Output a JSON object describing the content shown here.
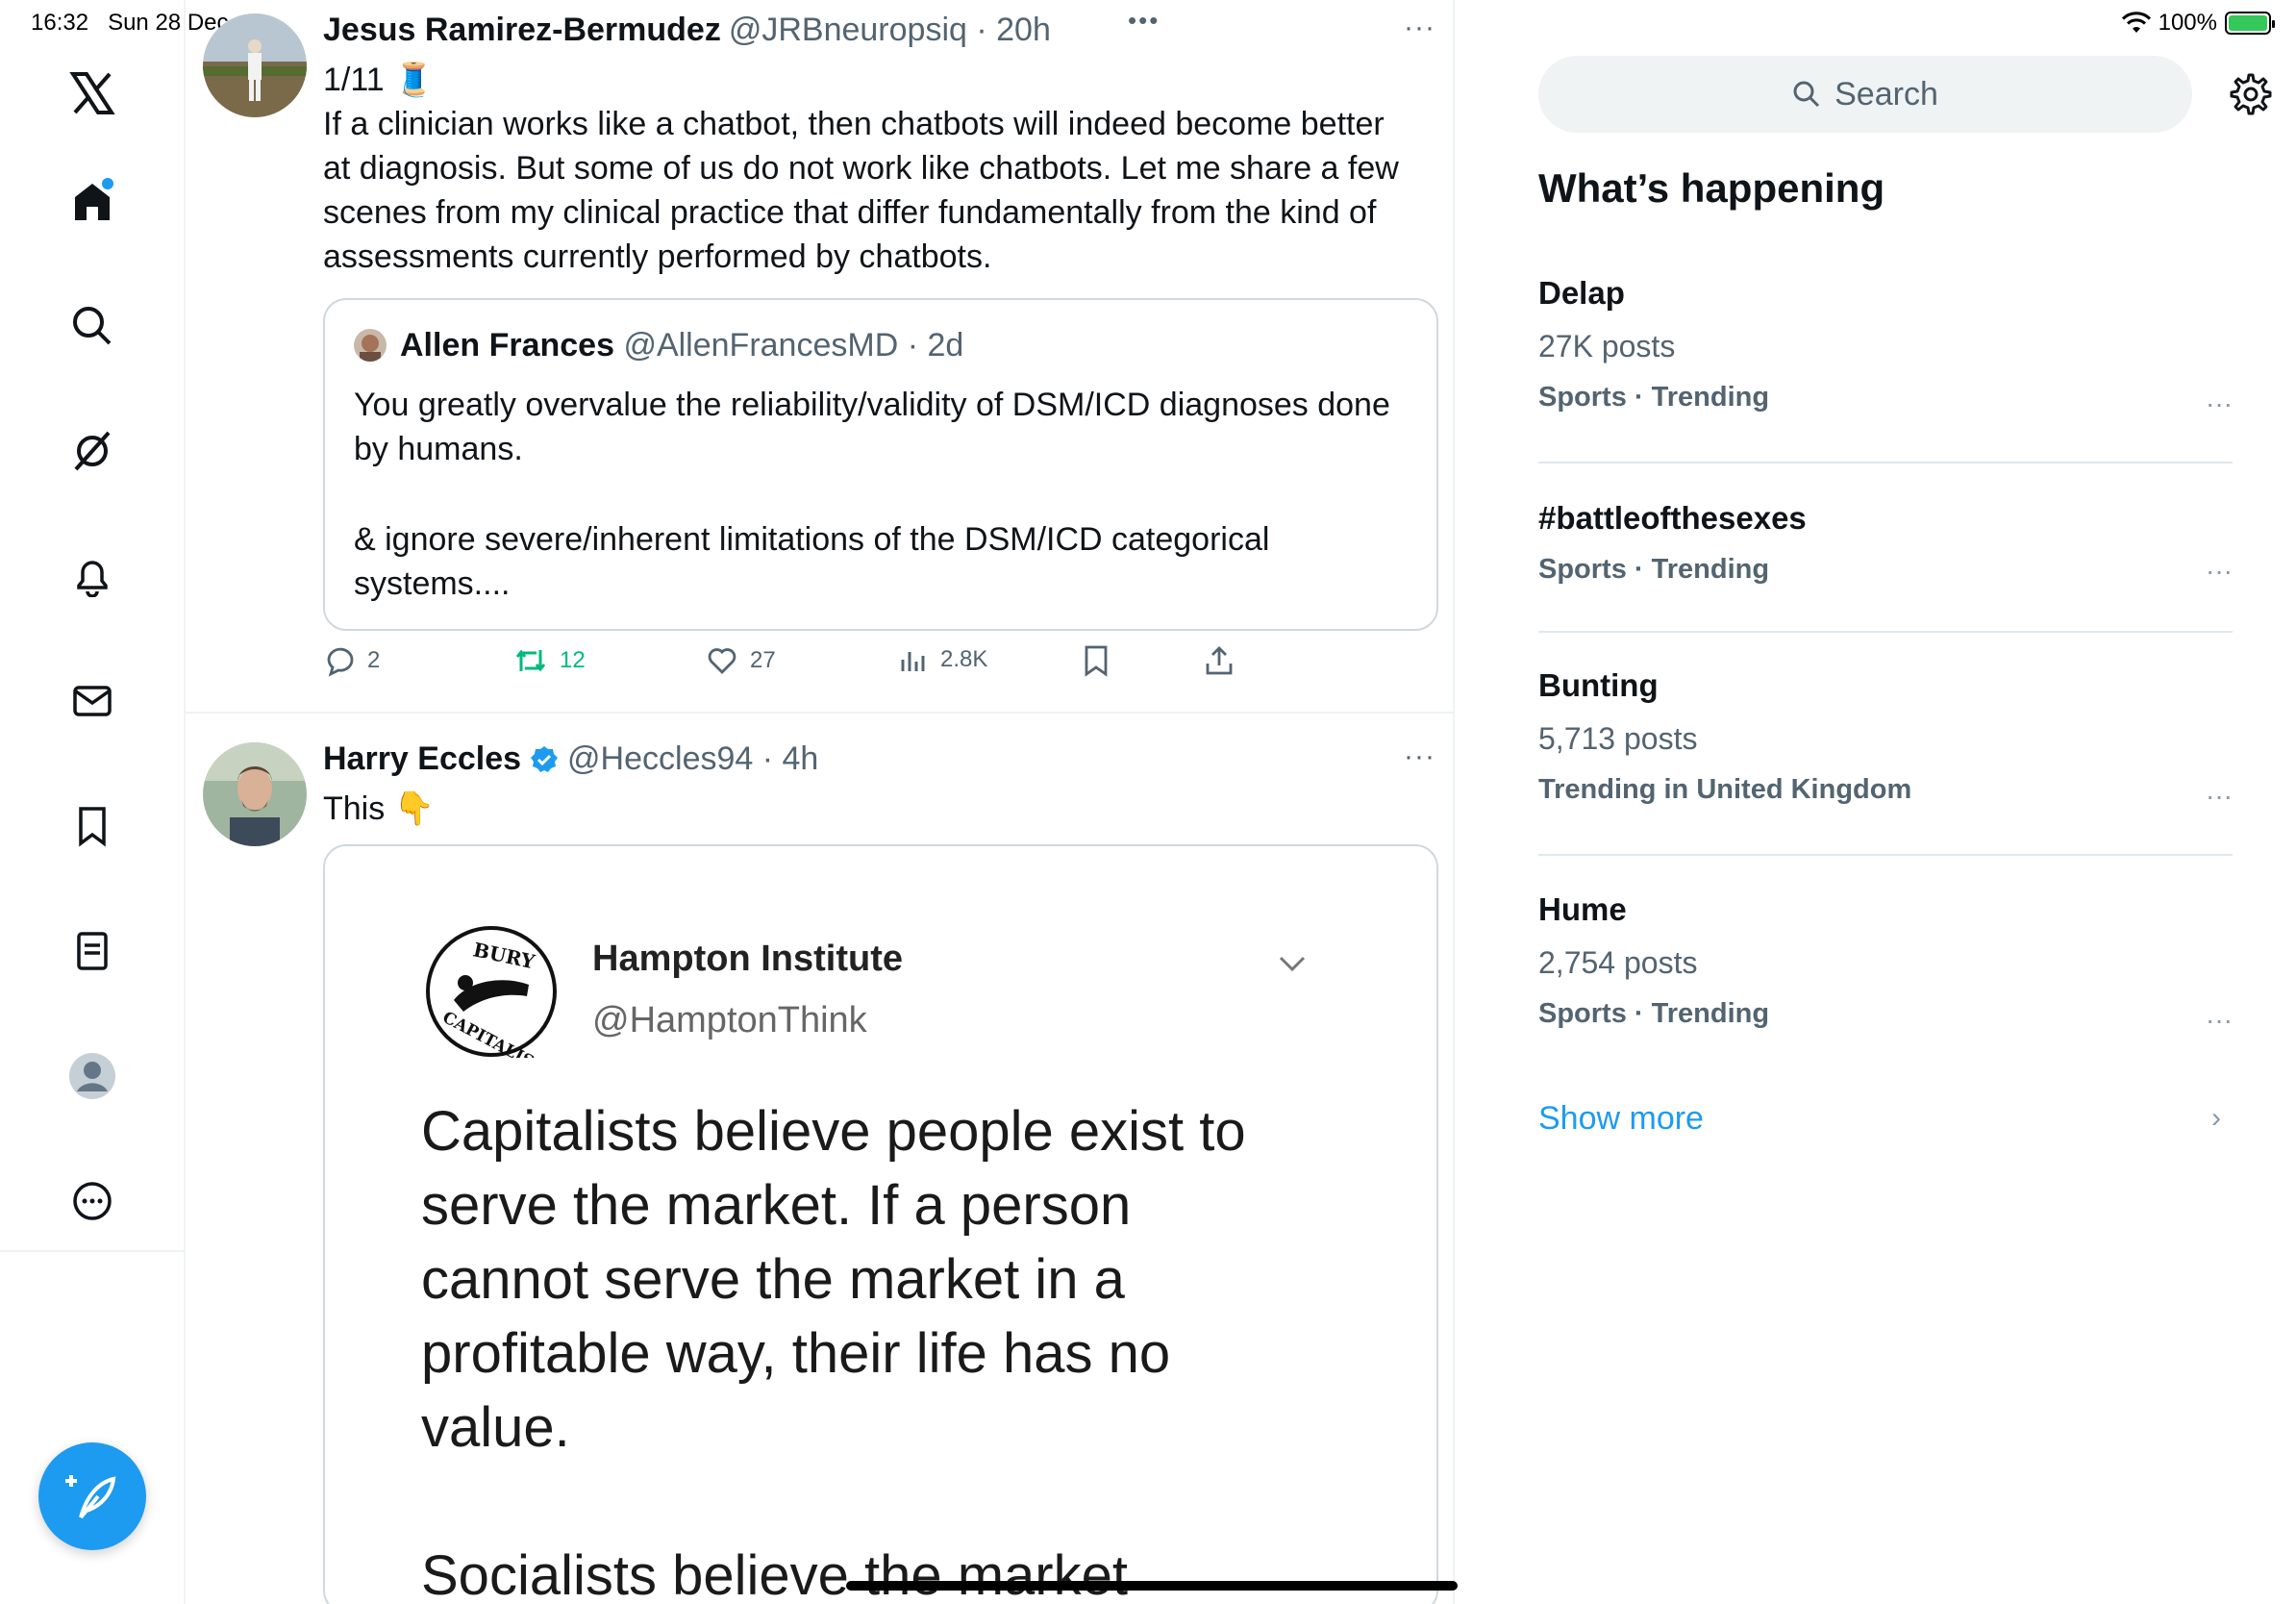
{
  "status_bar": {
    "time": "16:32",
    "date": "Sun 28 Dec",
    "battery": "100%"
  },
  "nav": {
    "items": [
      {
        "icon": "x-logo-icon"
      },
      {
        "icon": "home-icon"
      },
      {
        "icon": "search-icon"
      },
      {
        "icon": "grok-icon"
      },
      {
        "icon": "bell-icon"
      },
      {
        "icon": "mail-icon"
      },
      {
        "icon": "bookmark-icon"
      },
      {
        "icon": "lists-icon"
      },
      {
        "icon": "profile-icon"
      },
      {
        "icon": "more-icon"
      }
    ],
    "compose_icon": "compose-feather-icon",
    "accent": "#1d9bf0"
  },
  "top_dots": "•••",
  "tweet1": {
    "name": "Jesus Ramirez-Bermudez",
    "handle_time": "@JRBneuropsiq · 20h",
    "line1": "1/11 🧵",
    "text": "If a clinician works like a chatbot, then chatbots will indeed become better at diagnosis. But some of us do not work like chatbots. Let me share a few scenes from my clinical practice that differ fundamentally from the kind of assessments currently performed by chatbots.",
    "quote": {
      "name": "Allen Frances",
      "handle_time": "@AllenFrancesMD · 2d",
      "text1": "You greatly overvalue the reliability/validity of DSM/ICD diagnoses done by humans.",
      "text2": "& ignore severe/inherent limitations of the DSM/ICD categorical systems...."
    },
    "actions": {
      "replies": "2",
      "reposts": "12",
      "likes": "27",
      "views": "2.8K"
    },
    "repost_color": "#00ba7c"
  },
  "tweet2": {
    "name": "Harry Eccles",
    "handle_time": "@Heccles94 · 4h",
    "text": "This 👇",
    "media": {
      "logo_text_top": "BURY",
      "logo_text_bottom": "CAPITALISM",
      "account_name": "Hampton Institute",
      "account_handle": "@HamptonThink",
      "body": "Capitalists believe people exist to serve the market. If a person cannot serve the market in a profitable way, their life has no value.",
      "body2": "Socialists believe the market"
    }
  },
  "sidebar": {
    "search_placeholder": "Search",
    "section_title": "What’s happening",
    "trends": [
      {
        "name": "Delap",
        "posts": "27K posts",
        "category": "Sports · Trending"
      },
      {
        "name": "#battleofthesexes",
        "posts": "",
        "category": "Sports · Trending"
      },
      {
        "name": "Bunting",
        "posts": "5,713 posts",
        "category": "Trending in United Kingdom"
      },
      {
        "name": "Hume",
        "posts": "2,754 posts",
        "category": "Sports · Trending"
      }
    ],
    "show_more": "Show more"
  }
}
